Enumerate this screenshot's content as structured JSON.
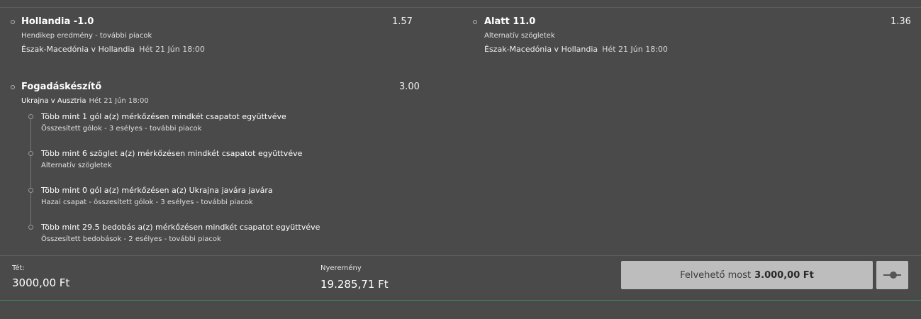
{
  "selections": [
    {
      "name": "Hollandia -1.0",
      "odds": "1.57",
      "market": "Hendikep eredmény - további piacok",
      "event": "Észak-Macedónia v Hollandia",
      "date": "Hét 21 Jún 18:00"
    },
    {
      "name": "Alatt 11.0",
      "odds": "1.36",
      "market": "Alternatív szögletek",
      "event": "Észak-Macedónia v Hollandia",
      "date": "Hét 21 Jún 18:00"
    }
  ],
  "betbuilder": {
    "name": "Fogadáskészítő",
    "odds": "3.00",
    "event": "Ukrajna v Ausztria",
    "date": "Hét 21 Jún 18:00",
    "legs": [
      {
        "title": "Több mint 1 gól a(z) mérkőzésen mindkét csapatot együttvéve",
        "subtitle": "Összesített gólok - 3 esélyes - további piacok"
      },
      {
        "title": "Több mint 6 szöglet a(z) mérkőzésen mindkét csapatot együttvéve",
        "subtitle": "Alternatív szögletek"
      },
      {
        "title": "Több mint 0 gól a(z) mérkőzésen a(z) Ukrajna javára javára",
        "subtitle": "Hazai csapat - összesített gólok - 3 esélyes - további piacok"
      },
      {
        "title": "Több mint 29.5 bedobás a(z) mérkőzésen mindkét csapatot együttvéve",
        "subtitle": "Összesített bedobások - 2 esélyes - további piacok"
      }
    ]
  },
  "footer": {
    "stake_label": "Tét:",
    "stake_value": "3000,00 Ft",
    "winnings_label": "Nyeremény",
    "winnings_value": "19.285,71 Ft",
    "cashout_label": "Felvehető most",
    "cashout_amount": "3.000,00 Ft",
    "slider_icon": "cashout-slider-icon"
  }
}
